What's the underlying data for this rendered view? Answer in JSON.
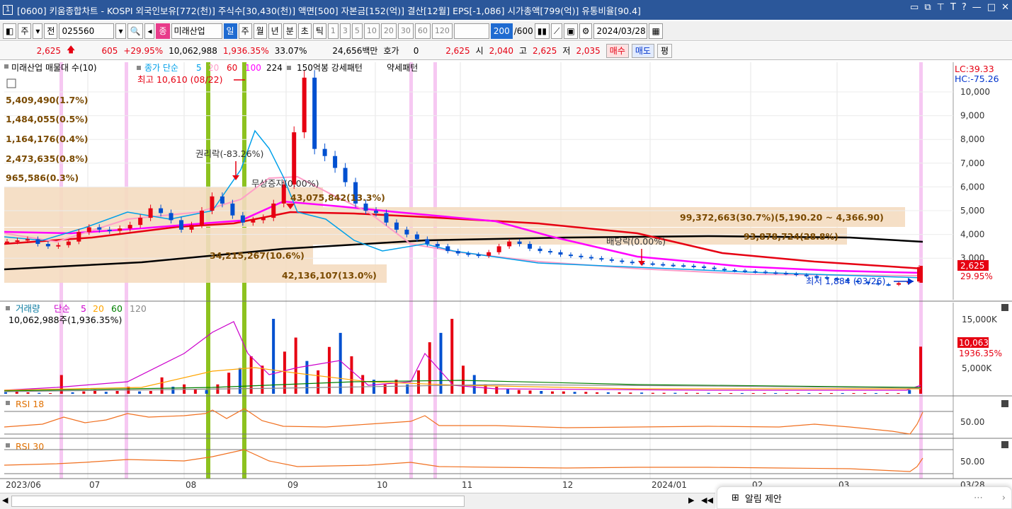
{
  "window": {
    "number": "1",
    "title": "[0600] 키움종합차트 - KOSPI 외국인보유[772(천)] 주식수[30,430(천)] 액면[500] 자본금[152(억)] 결산[12월] EPS[-1,086] 시가총액[799(억)] 유통비율[90.4]",
    "buttons": [
      "▭",
      "⧉",
      "⊤",
      "T",
      "?",
      "—",
      "□",
      "✕"
    ]
  },
  "toolbar": {
    "period_select": "주",
    "prev_label": "전",
    "stock_code": "025560",
    "stock_badge": "종",
    "stock_name": "미래산업",
    "periods": [
      "일",
      "주",
      "월",
      "년",
      "분",
      "초",
      "틱"
    ],
    "active_period": "일",
    "intervals": [
      "1",
      "3",
      "5",
      "10",
      "20",
      "30",
      "60",
      "120"
    ],
    "count": "200",
    "count_total": "/600",
    "date": "2024/03/28"
  },
  "quote": {
    "price": "2,625",
    "change": "605",
    "change_pct": "+29.95%",
    "volume": "10,062,988",
    "volume_pct": "1,936.35%",
    "turnover_pct": "33.07%",
    "amount": "24,656백만",
    "hoga_label": "호가",
    "hoga_value": "0",
    "hoga_price": "2,625",
    "open_label": "시",
    "open": "2,040",
    "high_label": "고",
    "high": "2,625",
    "low_label": "저",
    "low": "2,035",
    "buy": "매수",
    "sell": "매도",
    "eval": "평"
  },
  "price_legend": {
    "name": "미래산업 매물대 수(10)",
    "ma_label": "종가 단순",
    "ma_periods": [
      "5",
      "20",
      "60",
      "100",
      "224"
    ],
    "ma_colors": [
      "#00a0e9",
      "#ff9ec8",
      "#e60012",
      "#ff00ff",
      "#000000"
    ],
    "extra1": "150억봉 강세패턴",
    "extra2": "약세패턴"
  },
  "annotations": {
    "high_mark": "최고 10,610 (08/22)",
    "low_mark": "최저 1,884 (03/26)",
    "rights": "권리락(-83.26%)",
    "bonus": "무상증자(0.00%)",
    "dividend": "배당락(0.00%)",
    "lc": "LC:39.33",
    "hc": "HC:-75.26"
  },
  "volume_profile": [
    {
      "label": "5,409,490(1.7%)"
    },
    {
      "label": "1,484,055(0.5%)"
    },
    {
      "label": "1,164,176(0.4%)"
    },
    {
      "label": "2,473,635(0.8%)"
    },
    {
      "label": "965,586(0.3%)"
    },
    {
      "label": "43,075,842(13.3%)"
    },
    {
      "label": "99,372,663(30.7%)(5,190.20 ~ 4,366.90)"
    },
    {
      "label": "93,878,724(28.8%)"
    },
    {
      "label": "34,215,267(10.6%)"
    },
    {
      "label": "42,136,107(13.0%)"
    }
  ],
  "price_axis": [
    "10,000",
    "9,000",
    "8,000",
    "7,000",
    "6,000",
    "5,000",
    "4,000",
    "3,000"
  ],
  "current_price_tag": "2,625",
  "current_pct_tag": "29.95%",
  "volume_panel": {
    "title": "거래량",
    "ma_label": "단순",
    "ma_periods": [
      "5",
      "20",
      "60",
      "120"
    ],
    "ma_colors": [
      "#cc00cc",
      "#ffa500",
      "#008000",
      "#888888"
    ],
    "value": "10,062,988주(1,936.35%)",
    "axis": [
      "15,000K",
      "5,000K"
    ],
    "tag_value": "10,063K",
    "tag_pct": "1936.35%"
  },
  "rsi18": {
    "title": "RSI 18",
    "axis": "50.00"
  },
  "rsi30": {
    "title": "RSI 30",
    "axis": "50.00"
  },
  "date_axis": [
    "2023/06",
    "07",
    "08",
    "09",
    "10",
    "11",
    "12",
    "2024/01",
    "02",
    "03",
    "03/28"
  ],
  "notice": "알림 제안",
  "chart_data": {
    "type": "candlestick",
    "title": "미래산업",
    "dates_range": [
      "2023/06",
      "2024/03/28"
    ],
    "ylim": [
      1500,
      10700
    ],
    "close_approx": [
      3700,
      3750,
      3800,
      3600,
      3500,
      3550,
      3700,
      4100,
      4300,
      4200,
      4150,
      4250,
      4400,
      4700,
      5100,
      4900,
      4600,
      4200,
      4400,
      5000,
      5600,
      5300,
      4800,
      4500,
      4600,
      4700,
      5300,
      6100,
      8300,
      10600,
      7600,
      7300,
      6800,
      6200,
      5300,
      5000,
      4900,
      4500,
      4200,
      4000,
      3800,
      3600,
      3500,
      3300,
      3200,
      3150,
      3100,
      3250,
      3500,
      3700,
      3600,
      3400,
      3300,
      3250,
      3150,
      3100,
      3050,
      3000,
      2950,
      2900,
      2850,
      2800,
      2780,
      2750,
      2720,
      2700,
      2680,
      2650,
      2600,
      2550,
      2500,
      2480,
      2450,
      2430,
      2400,
      2380,
      2350,
      2300,
      2250,
      2200,
      2150,
      2100,
      2050,
      2000,
      1950,
      1900,
      1884,
      1950,
      2020,
      2625
    ],
    "volume_k_approx": [
      300,
      500,
      300,
      200,
      150,
      4000,
      300,
      500,
      800,
      400,
      600,
      1500,
      500,
      600,
      3500,
      1500,
      2000,
      1000,
      800,
      2000,
      4500,
      5500,
      8000,
      6000,
      16000,
      9000,
      12000,
      7000,
      5000,
      10000,
      13000,
      8000,
      4000,
      3000,
      2000,
      3000,
      2000,
      5000,
      11000,
      13000,
      16000,
      6000,
      4000,
      2000,
      1500,
      1000,
      800,
      700,
      600,
      500,
      500,
      400,
      400,
      300,
      300,
      300,
      250,
      250,
      200,
      200,
      200,
      200,
      180,
      180,
      150,
      150,
      150,
      150,
      150,
      120,
      120,
      120,
      100,
      100,
      100,
      100,
      100,
      100,
      100,
      100,
      100,
      800,
      10063
    ]
  }
}
